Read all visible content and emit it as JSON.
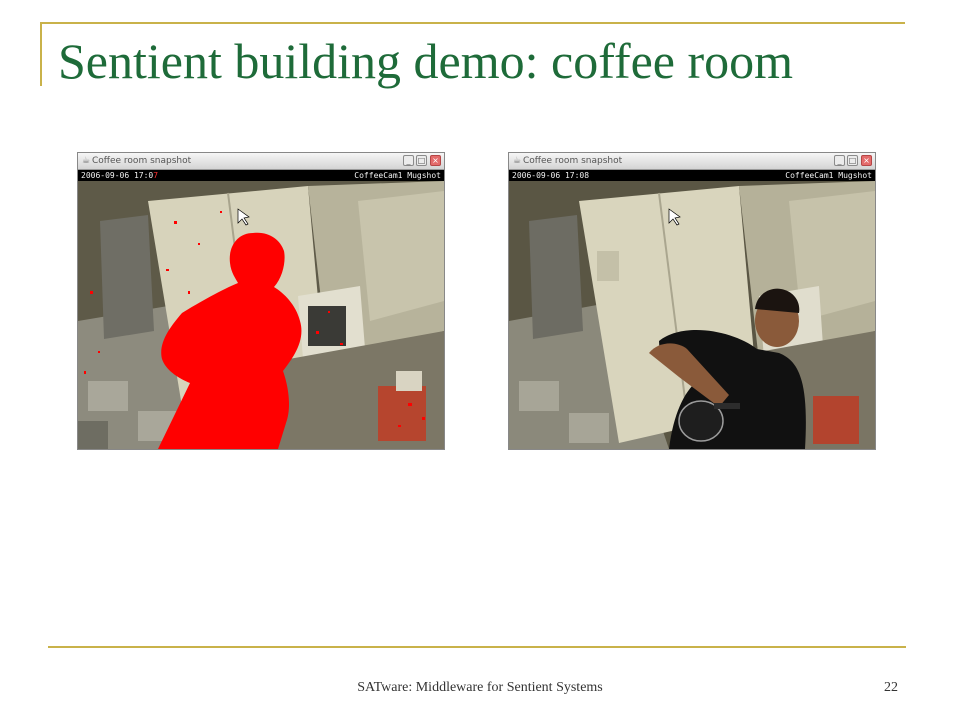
{
  "slide": {
    "title": "Sentient building demo: coffee room",
    "footer": "SATware: Middleware for Sentient Systems",
    "page_number": "22"
  },
  "windows": [
    {
      "title": "Coffee room snapshot",
      "timestamp": "2006-09-06 17:0",
      "timestamp_highlight": "7",
      "camera": "CoffeeCam1 Mugshot",
      "view": "segmented person (red silhouette)"
    },
    {
      "title": "Coffee room snapshot",
      "timestamp": "2006-09-06 17:08",
      "camera": "CoffeeCam1 Mugshot",
      "view": "person pouring coffee"
    }
  ],
  "colors": {
    "title_green": "#1e6b39",
    "rule_gold": "#c9b24a",
    "segmentation_red": "#ff0000"
  }
}
